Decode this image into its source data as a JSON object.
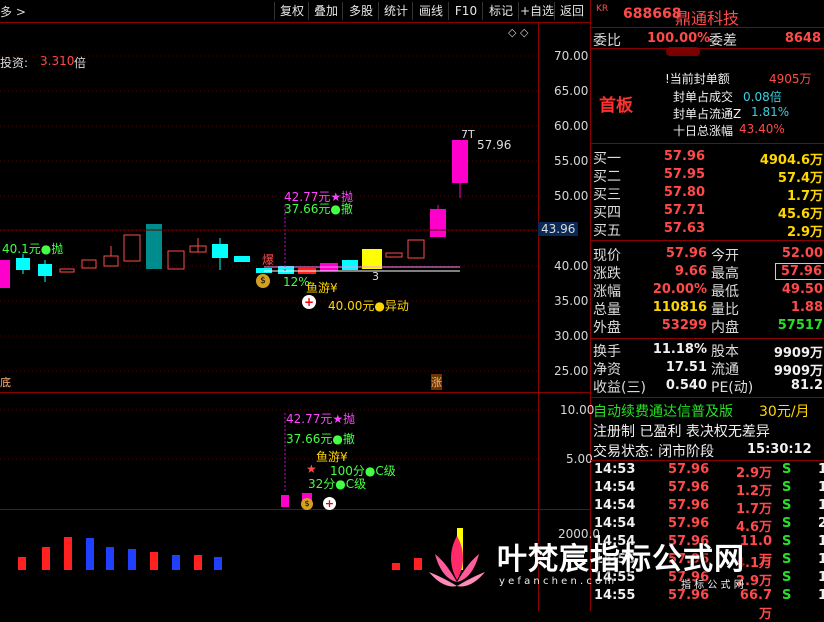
{
  "toolbar": {
    "left_label": "多 >",
    "buttons": [
      "复权",
      "叠加",
      "多股",
      "统计",
      "画线",
      "F10",
      "标记",
      "+自选",
      "返回"
    ],
    "diamond_icons": "◇ ◇"
  },
  "stock": {
    "market_tag": "KR",
    "code": "688668",
    "name": "鼎通科技"
  },
  "main_chart": {
    "indicator_label": "投资:",
    "indicator_value": "3.310",
    "indicator_unit": "倍",
    "y_ticks": [
      "70.00",
      "65.00",
      "60.00",
      "55.00",
      "50.00",
      "45.00",
      "40.00",
      "35.00",
      "30.00",
      "25.00"
    ],
    "current_price_tag": "43.96",
    "annotations": {
      "peak_label": "7T",
      "peak_price": "57.96",
      "sell_label": "42.77元★抛",
      "retreat_label": "37.66元●撤",
      "left_label": "40.1元●抛",
      "bao": "爆",
      "yu_you": "鱼游¥",
      "pct": "12%",
      "abnormal": "40.00元●异动",
      "three": "3",
      "left_bottom_char": "底",
      "bottom_mark": "涨"
    }
  },
  "sub_chart": {
    "y_ticks": [
      "10.00",
      "5.00"
    ],
    "annotations": {
      "sell": "42.77元★抛",
      "retreat": "37.66元●撤",
      "yu_you": "鱼游¥",
      "pass_c": "100分●C级",
      "thirty_two": "32分●C级",
      "star_prefix": "★"
    }
  },
  "vol_chart": {
    "y_tick": "2000.0",
    "bars_red": [
      0.35,
      0.55,
      0.75,
      0.55
    ],
    "bars_blue": [
      0.7,
      0.5,
      0.5,
      0.4,
      0.3,
      0.3
    ]
  },
  "order_book": {
    "weibi_label": "委比",
    "weibi_value": "100.00%",
    "weicha_label": "委差",
    "weicha_value": "8648",
    "first_board": "首板",
    "stats": [
      {
        "label": "!当前封单额",
        "value": "4905万",
        "color": "#ff4a4a"
      },
      {
        "label": "封单占成交",
        "value": "0.08倍",
        "color": "#3ccfe0"
      },
      {
        "label": "封单占流通Z",
        "value": "1.81%",
        "color": "#3ccfe0"
      },
      {
        "label": "十日总涨幅",
        "value": "43.40%",
        "color": "#ff4a4a"
      }
    ],
    "bids": [
      {
        "label": "买一",
        "price": "57.96",
        "vol": "4904.6万"
      },
      {
        "label": "买二",
        "price": "57.95",
        "vol": "57.4万"
      },
      {
        "label": "买三",
        "price": "57.80",
        "vol": "1.7万"
      },
      {
        "label": "买四",
        "price": "57.71",
        "vol": "45.6万"
      },
      {
        "label": "买五",
        "price": "57.63",
        "vol": "2.9万"
      }
    ]
  },
  "quote": {
    "rows": [
      {
        "l1": "现价",
        "v1": "57.96",
        "c1": "#ff4a4a",
        "l2": "今开",
        "v2": "52.00",
        "c2": "#ff4a4a"
      },
      {
        "l1": "涨跌",
        "v1": "9.66",
        "c1": "#ff4a4a",
        "l2": "最高",
        "v2": "57.96",
        "c2": "#ff4a4a"
      },
      {
        "l1": "涨幅",
        "v1": "20.00%",
        "c1": "#ff4a4a",
        "l2": "最低",
        "v2": "49.50",
        "c2": "#ff4a4a"
      },
      {
        "l1": "总量",
        "v1": "110816",
        "c1": "#ffd700",
        "l2": "量比",
        "v2": "1.88",
        "c2": "#ff4a4a"
      },
      {
        "l1": "外盘",
        "v1": "53299",
        "c1": "#ff4a4a",
        "l2": "内盘",
        "v2": "57517",
        "c2": "#25e025"
      }
    ],
    "rows2": [
      {
        "l1": "换手",
        "v1": "11.18%",
        "l2": "股本",
        "v2": "9909万"
      },
      {
        "l1": "净资",
        "v1": "17.51",
        "l2": "流通",
        "v2": "9909万"
      },
      {
        "l1": "收益(三)",
        "v1": "0.540",
        "l2": "PE(动)",
        "v2": "81.2"
      }
    ]
  },
  "promo": {
    "auto_renew": "自动续费通达信普及版",
    "price": "30元/月",
    "reg": "注册制 已盈利 表决权无差异",
    "status_label": "交易状态: 闭市阶段",
    "status_time": "15:30:12"
  },
  "trades": [
    {
      "time": "14:53",
      "price": "57.96",
      "vol": "2.9万",
      "side": "S",
      "n": "1"
    },
    {
      "time": "14:54",
      "price": "57.96",
      "vol": "1.2万",
      "side": "S",
      "n": "1"
    },
    {
      "time": "14:54",
      "price": "57.96",
      "vol": "1.7万",
      "side": "S",
      "n": "1"
    },
    {
      "time": "14:54",
      "price": "57.96",
      "vol": "4.6万",
      "side": "S",
      "n": "2"
    },
    {
      "time": "14:54",
      "price": "57.96",
      "vol": "11.0万",
      "side": "S",
      "n": "1"
    },
    {
      "time": "14:55",
      "price": "57.96",
      "vol": "4.1万",
      "side": "S",
      "n": "1"
    },
    {
      "time": "14:55",
      "price": "57.96",
      "vol": "2.9万",
      "side": "S",
      "n": "1"
    },
    {
      "time": "14:55",
      "price": "57.96",
      "vol": "66.7万",
      "side": "S",
      "n": "1"
    }
  ],
  "watermark": {
    "title": "叶梵宸指标公式网",
    "url": "y e f a n c h e n . c o m",
    "caption": "指 标 公 式 网"
  }
}
